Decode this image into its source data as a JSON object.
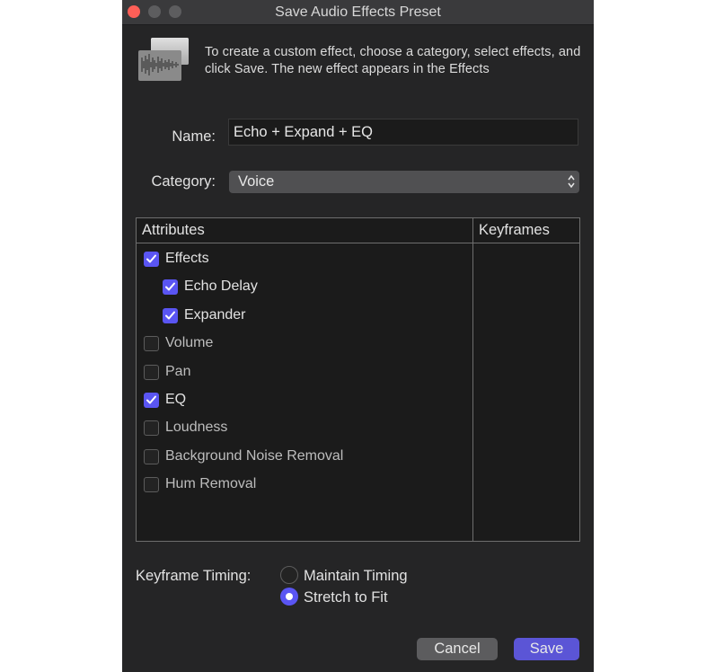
{
  "window": {
    "title": "Save Audio Effects Preset",
    "description": "To create a custom effect, choose a category, select effects, and click Save. The new effect appears in the Effects",
    "icon": "audio-waveform-icon"
  },
  "form": {
    "name_label": "Name:",
    "name_value": "Echo + Expand + EQ",
    "category_label": "Category:",
    "category_value": "Voice"
  },
  "table": {
    "headers": {
      "attributes": "Attributes",
      "keyframes": "Keyframes"
    },
    "rows": [
      {
        "label": "Effects",
        "checked": true,
        "indent": 0
      },
      {
        "label": "Echo Delay",
        "checked": true,
        "indent": 1
      },
      {
        "label": "Expander",
        "checked": true,
        "indent": 1
      },
      {
        "label": "Volume",
        "checked": false,
        "indent": 0
      },
      {
        "label": "Pan",
        "checked": false,
        "indent": 0
      },
      {
        "label": "EQ",
        "checked": true,
        "indent": 0
      },
      {
        "label": "Loudness",
        "checked": false,
        "indent": 0
      },
      {
        "label": "Background Noise Removal",
        "checked": false,
        "indent": 0
      },
      {
        "label": "Hum Removal",
        "checked": false,
        "indent": 0
      }
    ]
  },
  "keyframe_timing": {
    "label": "Keyframe Timing:",
    "options": [
      {
        "label": "Maintain Timing",
        "selected": false
      },
      {
        "label": "Stretch to Fit",
        "selected": true
      }
    ]
  },
  "buttons": {
    "cancel": "Cancel",
    "save": "Save"
  },
  "colors": {
    "accent": "#5a55f3",
    "window_bg": "#252526",
    "close_button": "#fe5f57"
  }
}
